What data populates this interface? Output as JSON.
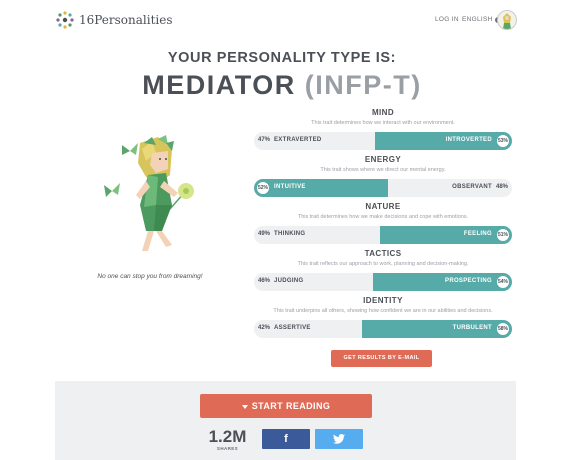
{
  "header": {
    "logo_text": "16Personalities",
    "login": "LOG IN",
    "language": "ENGLISH"
  },
  "result": {
    "label": "YOUR PERSONALITY TYPE IS:",
    "type_name": "MEDIATOR",
    "type_code": "(INFP-T)"
  },
  "quote": "No one can stop you from dreaming!",
  "traits": [
    {
      "name": "MIND",
      "desc": "This trait determines how we interact with our environment.",
      "left_label": "EXTRAVERTED",
      "left_pct": "47%",
      "right_label": "INTROVERTED",
      "right_pct": "53%",
      "dominant": "right",
      "value": 53
    },
    {
      "name": "ENERGY",
      "desc": "This trait shows where we direct our mental energy.",
      "left_label": "INTUITIVE",
      "left_pct": "52%",
      "right_label": "OBSERVANT",
      "right_pct": "48%",
      "dominant": "left",
      "value": 52
    },
    {
      "name": "NATURE",
      "desc": "This trait determines how we make decisions and cope with emotions.",
      "left_label": "THINKING",
      "left_pct": "49%",
      "right_label": "FEELING",
      "right_pct": "51%",
      "dominant": "right",
      "value": 51
    },
    {
      "name": "TACTICS",
      "desc": "This trait reflects our approach to work, planning and decision-making.",
      "left_label": "JUDGING",
      "left_pct": "46%",
      "right_label": "PROSPECTING",
      "right_pct": "54%",
      "dominant": "right",
      "value": 54
    },
    {
      "name": "IDENTITY",
      "desc": "This trait underpins all others, showing how confident we are in our abilities and decisions.",
      "left_label": "ASSERTIVE",
      "left_pct": "42%",
      "right_label": "TURBULENT",
      "right_pct": "58%",
      "dominant": "right",
      "value": 58
    }
  ],
  "email_button": "GET RESULTS BY E-MAIL",
  "footer": {
    "read_button": "START READING",
    "share_count": "1.2M",
    "share_label": "SHARES"
  },
  "colors": {
    "accent": "#56aaa7",
    "cta": "#df6b57",
    "facebook": "#3b5a9a",
    "twitter": "#55acee"
  },
  "icons": [
    "logo-icon",
    "globe-icon",
    "avatar",
    "mediator-illustration",
    "caret-down-icon",
    "facebook-icon",
    "twitter-icon"
  ]
}
